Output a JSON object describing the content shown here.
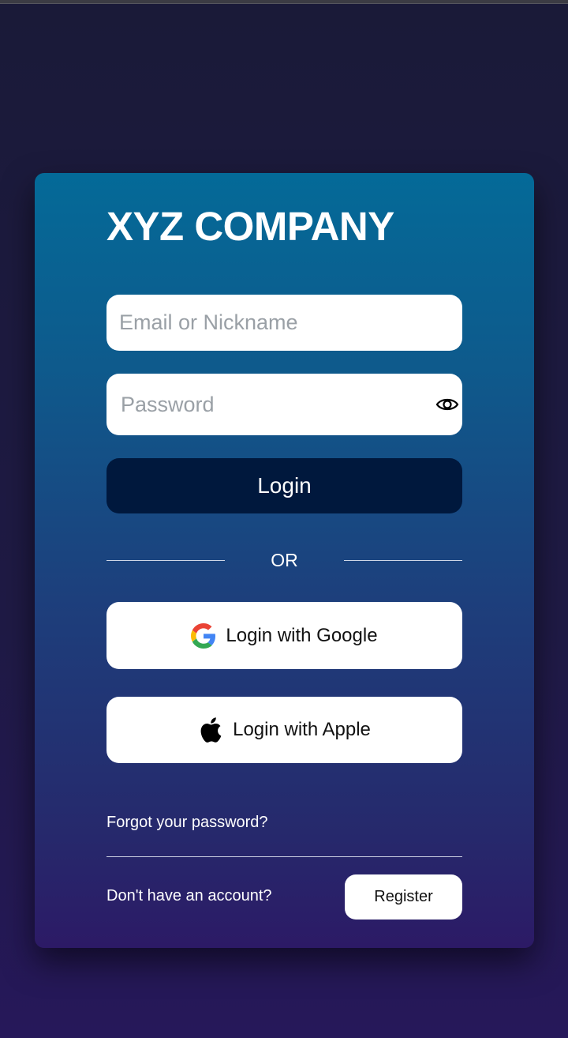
{
  "app": {
    "title": "XYZ COMPANY"
  },
  "form": {
    "email_placeholder": "Email or Nickname",
    "email_value": "",
    "password_placeholder": "Password",
    "password_value": "",
    "login_label": "Login"
  },
  "divider": {
    "or_label": "OR"
  },
  "social": {
    "google_label": "Login with Google",
    "apple_label": "Login with Apple"
  },
  "footer": {
    "forgot_label": "Forgot your password?",
    "no_account_label": "Don't have an account?",
    "register_label": "Register"
  },
  "icons": {
    "password_toggle": "eye-icon",
    "google": "google-logo-icon",
    "apple": "apple-logo-icon"
  },
  "colors": {
    "login_button": "#00183d",
    "card_top": "#046a98",
    "card_bottom": "#2c1a66",
    "background": "#1a1a38"
  }
}
